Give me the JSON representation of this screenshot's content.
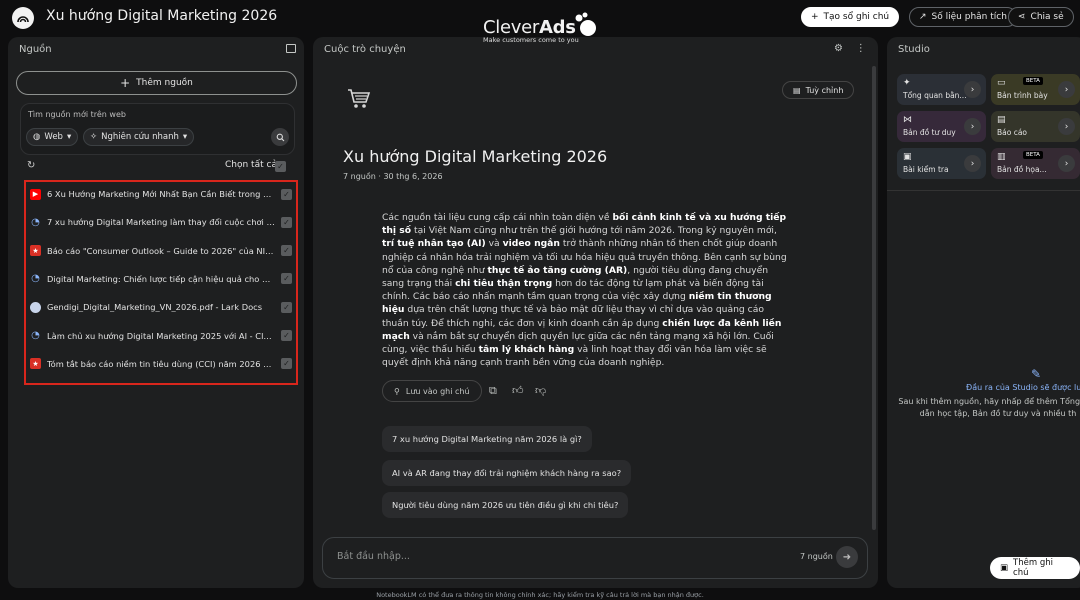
{
  "header": {
    "title": "Xu hướng Digital Marketing 2026",
    "create_note_label": "Tạo sổ ghi chú",
    "analytics_label": "Số liệu phân tích",
    "share_label": "Chia sẻ"
  },
  "sources": {
    "title": "Nguồn",
    "add_label": "Thêm nguồn",
    "search_placeholder": "Tìm nguồn mới trên web",
    "web_chip": "Web",
    "research_chip": "Nghiên cứu nhanh",
    "select_all_label": "Chọn tất cả",
    "items": [
      {
        "title": "6 Xu Hướng Marketing Mới Nhất Bạn Cần Biết trong 2025",
        "icon": "youtube-icon",
        "color": "#ff0000"
      },
      {
        "title": "7 xu hướng Digital Marketing làm thay đổi cuộc chơi giữ...",
        "icon": "website-icon",
        "color": "#8ab4f8"
      },
      {
        "title": "Báo cáo \"Consumer Outlook – Guide to 2026\" của NIQ...",
        "icon": "red-star-icon",
        "color": "#d93025"
      },
      {
        "title": "Digital Marketing: Chiến lược tiếp cận hiệu quả cho doa...",
        "icon": "website-icon",
        "color": "#8ab4f8"
      },
      {
        "title": "Gendigi_Digital_Marketing_VN_2026.pdf - Lark Docs",
        "icon": "globe-icon",
        "color": "#8ab4f8"
      },
      {
        "title": "Làm chủ xu hướng Digital Marketing 2025 với AI - Cleve...",
        "icon": "website-icon",
        "color": "#8ab4f8"
      },
      {
        "title": "Tóm tắt báo cáo niềm tin tiêu dùng (CCI) năm 2026 của...",
        "icon": "red-star-icon",
        "color": "#d93025"
      }
    ]
  },
  "chat": {
    "title": "Cuộc trò chuyện",
    "customize_label": "Tuỳ chỉnh",
    "notebook_title": "Xu hướng Digital Marketing 2026",
    "meta": "7 nguồn · 30 thg 6, 2026",
    "summary_parts": [
      {
        "t": "Các nguồn tài liệu cung cấp cái nhìn toàn diện về ",
        "b": false
      },
      {
        "t": "bối cảnh kinh tế và xu hướng tiếp thị số",
        "b": true
      },
      {
        "t": " tại Việt Nam cũng như trên thế giới hướng tới năm 2026. Trong kỷ nguyên mới, ",
        "b": false
      },
      {
        "t": "trí tuệ nhân tạo (AI)",
        "b": true
      },
      {
        "t": " và ",
        "b": false
      },
      {
        "t": "video ngắn",
        "b": true
      },
      {
        "t": " trở thành những nhân tố then chốt giúp doanh nghiệp cá nhân hóa trải nghiệm và tối ưu hóa hiệu quả truyền thông. Bên cạnh sự bùng nổ của công nghệ như ",
        "b": false
      },
      {
        "t": "thực tế ảo tăng cường (AR)",
        "b": true
      },
      {
        "t": ", người tiêu dùng đang chuyển sang trạng thái ",
        "b": false
      },
      {
        "t": "chi tiêu thận trọng",
        "b": true
      },
      {
        "t": " hơn do tác động từ lạm phát và biến động tài chính. Các báo cáo nhấn mạnh tầm quan trọng của việc xây dựng ",
        "b": false
      },
      {
        "t": "niềm tin thương hiệu",
        "b": true
      },
      {
        "t": " dựa trên chất lượng thực tế và bảo mật dữ liệu thay vì chỉ dựa vào quảng cáo thuần túy. Để thích nghi, các đơn vị kinh doanh cần áp dụng ",
        "b": false
      },
      {
        "t": "chiến lược đa kênh liền mạch",
        "b": true
      },
      {
        "t": " và nắm bắt sự chuyển dịch quyền lực giữa các nền tảng mạng xã hội lớn. Cuối cùng, việc thấu hiểu ",
        "b": false
      },
      {
        "t": "tâm lý khách hàng",
        "b": true
      },
      {
        "t": " và linh hoạt thay đổi văn hóa làm việc sẽ quyết định khả năng cạnh tranh bền vững của doanh nghiệp.",
        "b": false
      }
    ],
    "save_note_label": "Lưu vào ghi chú",
    "suggestions": [
      "7 xu hướng Digital Marketing năm 2026 là gì?",
      "AI và AR đang thay đổi trải nghiệm khách hàng ra sao?",
      "Người tiêu dùng năm 2026 ưu tiên điều gì khi chi tiêu?"
    ],
    "input_placeholder": "Bắt đầu nhập...",
    "source_count": "7 nguồn"
  },
  "brand": {
    "name_light": "Clever",
    "name_bold": "Ads",
    "tagline": "Make customers come to you"
  },
  "studio": {
    "title": "Studio",
    "tiles": [
      {
        "label": "Tổng quan bằn...",
        "icon": "audio-overview-icon",
        "bg": "#2b2f36",
        "beta": false
      },
      {
        "label": "Bản trình bày",
        "icon": "slides-icon",
        "bg": "#3a3a25",
        "beta": true
      },
      {
        "label": "Bản đồ tư duy",
        "icon": "mindmap-icon",
        "bg": "#36293a",
        "beta": false
      },
      {
        "label": "Báo cáo",
        "icon": "report-icon",
        "bg": "#34352a",
        "beta": false
      },
      {
        "label": "Bài kiểm tra",
        "icon": "quiz-icon",
        "bg": "#2a3036",
        "beta": false
      },
      {
        "label": "Bản đồ họa...",
        "icon": "infographic-icon",
        "bg": "#352a33",
        "beta": true
      }
    ],
    "beta_label": "BETA",
    "empty_title": "Đầu ra của Studio sẽ được lưu",
    "empty_desc_1": "Sau khi thêm nguồn, hãy nhấp để thêm Tổng qua",
    "empty_desc_2": "dẫn học tập, Bản đồ tư duy và nhiều th",
    "add_note_label": "Thêm ghi chú"
  },
  "footer": "NotebookLM có thể đưa ra thông tin không chính xác; hãy kiểm tra kỹ câu trả lời mà bạn nhận được."
}
